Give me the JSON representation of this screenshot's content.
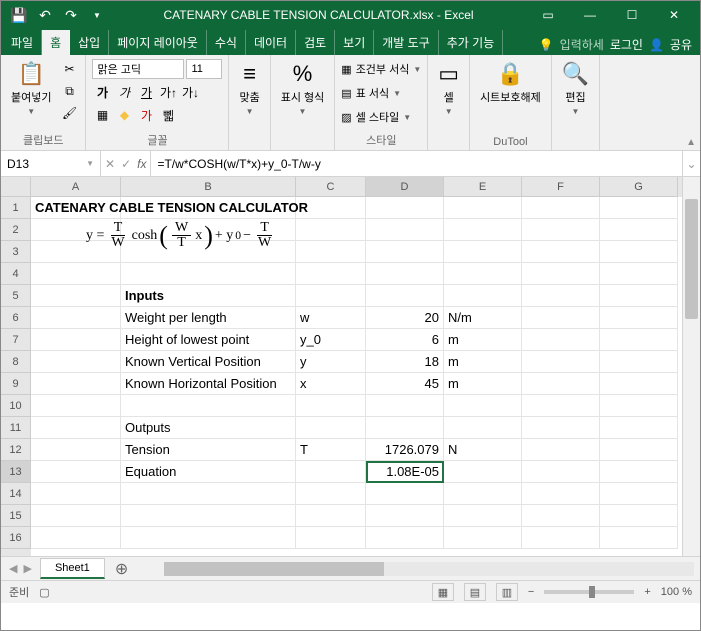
{
  "titlebar": {
    "filename": "CATENARY CABLE TENSION CALCULATOR.xlsx - Excel"
  },
  "ribbon": {
    "tabs": [
      "파일",
      "홈",
      "삽입",
      "페이지 레이아웃",
      "수식",
      "데이터",
      "검토",
      "보기",
      "개발 도구",
      "추가 기능"
    ],
    "tell_me": "입력하세",
    "signin": "로그인",
    "share": "공유",
    "groups": {
      "clipboard": "클립보드",
      "paste": "붙여넣기",
      "font": "글꼴",
      "font_name": "맑은 고딕",
      "font_size": "11",
      "align": "맞춤",
      "number": "표시 형식",
      "percent": "%",
      "styles": "스타일",
      "cond": "조건부 서식",
      "table": "표 서식",
      "cellsty": "셀 스타일",
      "cells": "셀",
      "dutool": "DuTool",
      "review": "시트보호해제",
      "edit": "편집"
    }
  },
  "namebox": "D13",
  "formula": "=T/w*COSH(w/T*x)+y_0-T/w-y",
  "sheet": {
    "cols": [
      "A",
      "B",
      "C",
      "D",
      "E",
      "F",
      "G"
    ],
    "rows": [
      "1",
      "2",
      "3",
      "4",
      "5",
      "6",
      "7",
      "8",
      "9",
      "10",
      "11",
      "12",
      "13",
      "14",
      "15",
      "16"
    ],
    "a1": "CATENARY CABLE TENSION CALCULATOR",
    "eq": {
      "y": "y =",
      "T": "T",
      "W": "W",
      "cosh": "cosh",
      "Wi": "W",
      "Ti": "T",
      "x": "x",
      "plus": "+ y",
      "sub0": "0",
      "minus": " −",
      "T2": "T",
      "W2": "W"
    },
    "b5": "Inputs",
    "b6": "Weight per length",
    "c6": "w",
    "d6": "20",
    "e6": "N/m",
    "b7": "Height of lowest point",
    "c7": "y_0",
    "d7": "6",
    "e7": "m",
    "b8": "Known Vertical Position",
    "c8": "y",
    "d8": "18",
    "e8": "m",
    "b9": "Known Horizontal Position",
    "c9": "x",
    "d9": "45",
    "e9": "m",
    "b11": "Outputs",
    "b12": "Tension",
    "c12": "T",
    "d12": "1726.079",
    "e12": "N",
    "b13": "Equation",
    "d13": "1.08E-05"
  },
  "tabs": {
    "sheet1": "Sheet1"
  },
  "status": {
    "ready": "준비",
    "zoom": "100 %"
  }
}
